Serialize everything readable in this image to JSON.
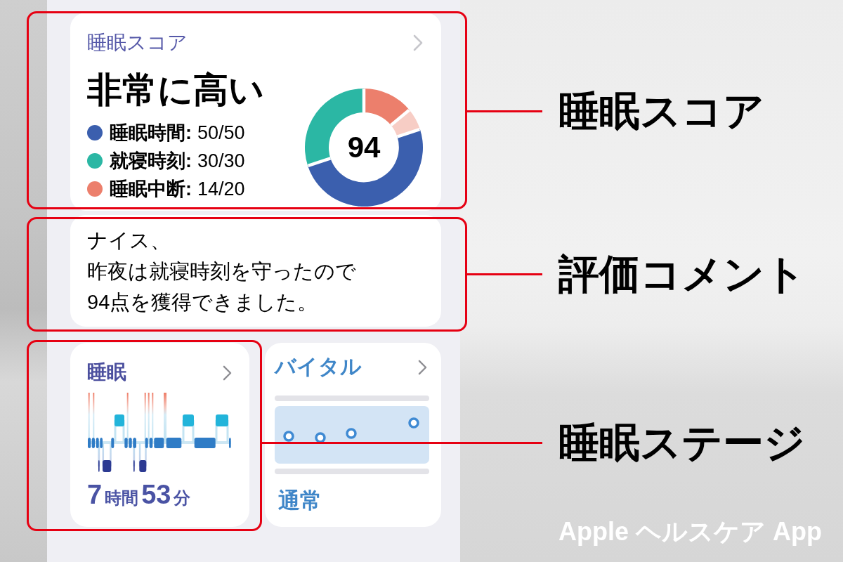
{
  "score_card": {
    "title": "睡眠スコア",
    "rating": "非常に高い",
    "legend": [
      {
        "label": "睡眠時間:",
        "value": "50/50",
        "color": "#3b5fae"
      },
      {
        "label": "就寝時刻:",
        "value": "30/30",
        "color": "#2bb7a4"
      },
      {
        "label": "睡眠中断:",
        "value": "14/20",
        "color": "#ec7f6c"
      }
    ],
    "score": "94",
    "chart_data": {
      "type": "donut",
      "series": [
        {
          "values": [
            14,
            6,
            50,
            30
          ],
          "colors": [
            "#ec7f6c",
            "#f7cdc5",
            "#3b5fae",
            "#2bb7a4"
          ]
        }
      ]
    }
  },
  "comment_card": {
    "lines": [
      "ナイス、",
      "昨夜は就寝時刻を守ったので",
      "94点を獲得できました。"
    ]
  },
  "sleep_card": {
    "title": "睡眠",
    "duration": [
      {
        "kind": "number",
        "text": "7"
      },
      {
        "kind": "unit",
        "text": "時間"
      },
      {
        "kind": "number",
        "text": "53"
      },
      {
        "kind": "unit",
        "text": "分"
      }
    ]
  },
  "vitals_card": {
    "title": "バイタル",
    "status": "通常"
  },
  "annotations": [
    {
      "label": "睡眠スコア"
    },
    {
      "label": "評価コメント"
    },
    {
      "label": "睡眠ステージ"
    }
  ],
  "caption": "Apple ヘルスケア App"
}
